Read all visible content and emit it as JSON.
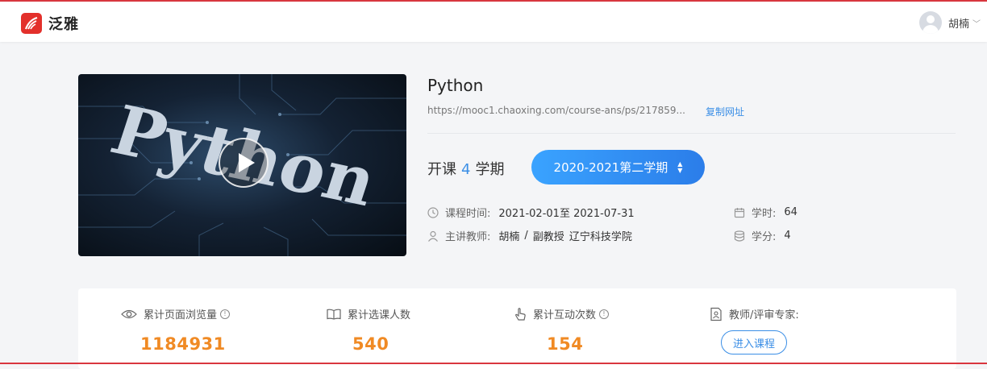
{
  "header": {
    "logo_text": "泛雅",
    "user_name": "胡楠"
  },
  "course": {
    "cover_text": "Python",
    "title": "Python",
    "url": "https://mooc1.chaoxing.com/course-ans/ps/217859...",
    "copy_label": "复制网址",
    "terms_prefix": "开课",
    "terms_count": "4",
    "terms_suffix": "学期",
    "term_selected": "2020-2021第二学期",
    "time_label": "课程时间:",
    "time_value": "2021-02-01至 2021-07-31",
    "teacher_label": "主讲教师:",
    "teacher_name": "胡楠",
    "teacher_sep": "/",
    "teacher_title": "副教授",
    "teacher_school": "辽宁科技学院",
    "hours_label": "学时:",
    "hours_value": "64",
    "credits_label": "学分:",
    "credits_value": "4"
  },
  "stats": {
    "views_label": "累计页面浏览量",
    "views_value": "1184931",
    "enrolled_label": "累计选课人数",
    "enrolled_value": "540",
    "interactions_label": "累计互动次数",
    "interactions_value": "154",
    "expert_label": "教师/评审专家:",
    "enter_label": "进入课程"
  },
  "colors": {
    "brand_red": "#e3302b",
    "accent_blue": "#3a8ee6",
    "stat_orange": "#f08a24"
  }
}
